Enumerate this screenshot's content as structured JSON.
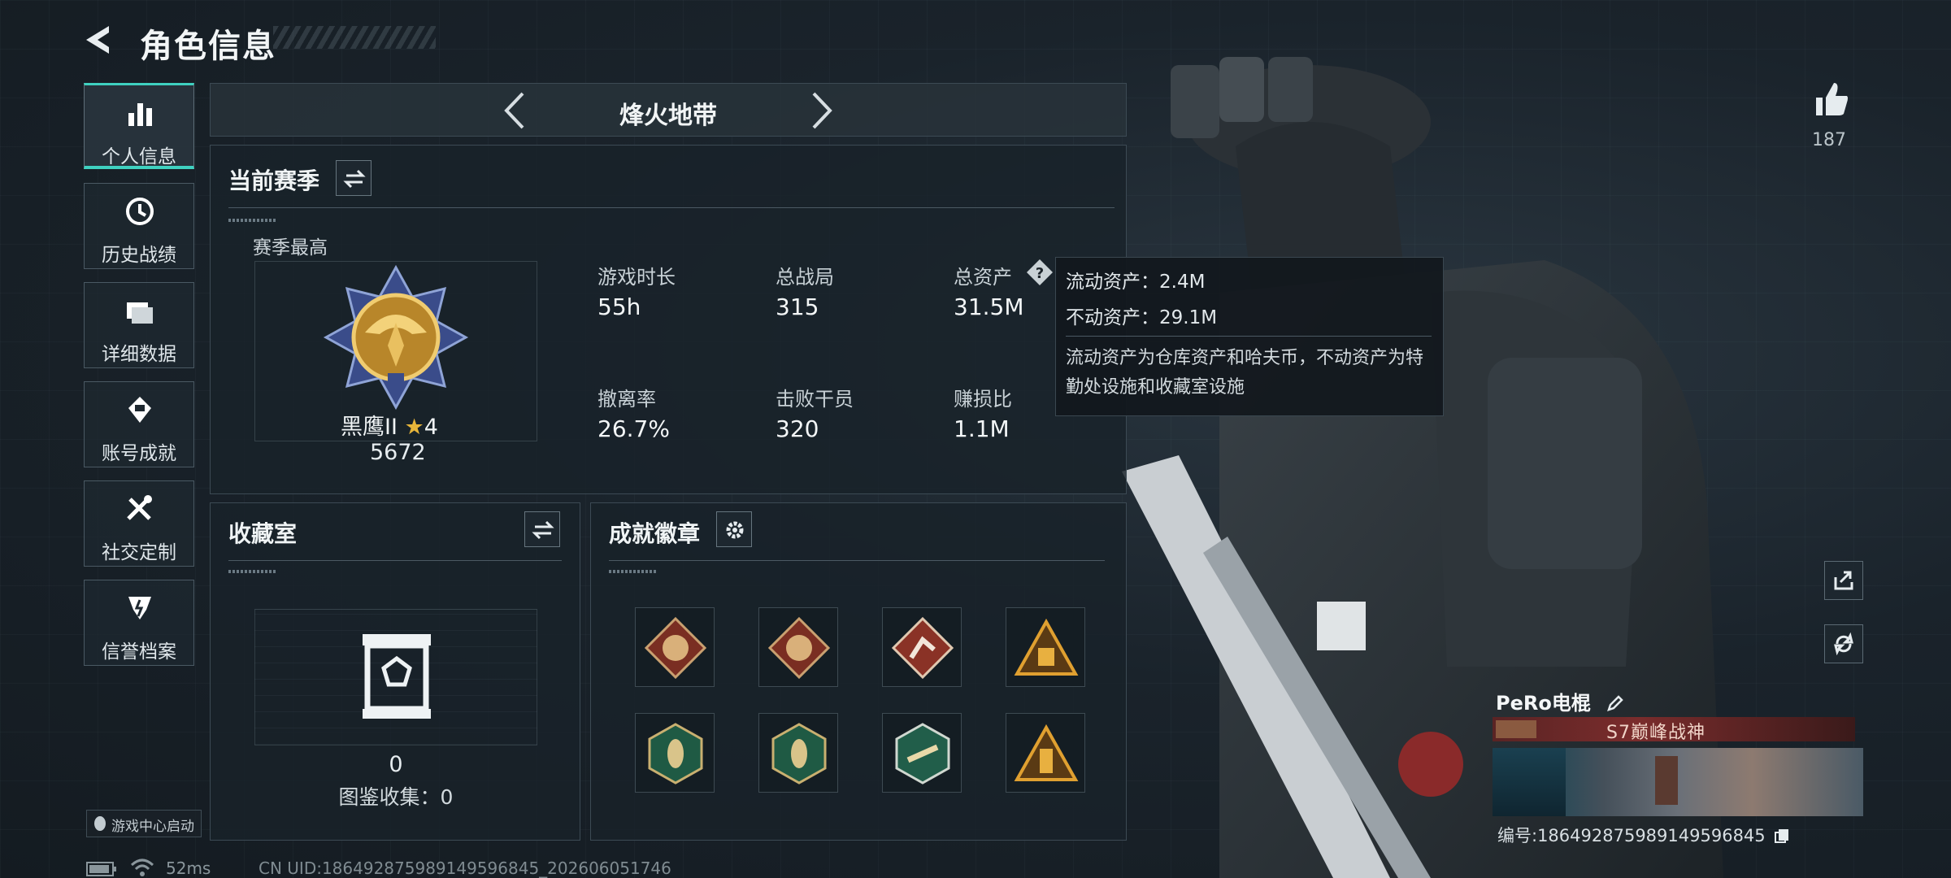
{
  "header": {
    "title": "角色信息"
  },
  "sidebar": {
    "items": [
      {
        "label": "个人信息",
        "icon": "bar-chart-icon",
        "active": true
      },
      {
        "label": "历史战绩",
        "icon": "history-clock-icon",
        "active": false
      },
      {
        "label": "详细数据",
        "icon": "folder-icon",
        "active": false
      },
      {
        "label": "账号成就",
        "icon": "achievement-icon",
        "active": false
      },
      {
        "label": "社交定制",
        "icon": "tools-icon",
        "active": false
      },
      {
        "label": "信誉档案",
        "icon": "shield-emblem-icon",
        "active": false
      }
    ],
    "game_center": "游戏中心启动"
  },
  "mode_switcher": {
    "title": "烽火地带"
  },
  "season": {
    "heading": "当前赛季",
    "best_label": "赛季最高",
    "rank_name": "黑鹰II",
    "rank_stars": "4",
    "rank_score": "5672",
    "stats": [
      {
        "label": "游戏时长",
        "value": "55h"
      },
      {
        "label": "总战局",
        "value": "315"
      },
      {
        "label": "总资产",
        "value": "31.5M"
      },
      {
        "label": "撤离率",
        "value": "26.7%"
      },
      {
        "label": "击败干员",
        "value": "320"
      },
      {
        "label": "赚损比",
        "value": "1.1M"
      }
    ]
  },
  "tooltip": {
    "liquid": "流动资产：2.4M",
    "fixed": "不动资产：29.1M",
    "desc": "流动资产为仓库资产和哈夫币，不动资产为特勤处设施和收藏室设施"
  },
  "collection": {
    "heading": "收藏室",
    "count": "0",
    "catalog": "图鉴收集：0"
  },
  "achievements": {
    "heading": "成就徽章",
    "badges": [
      "dragon-badge-red",
      "dragon-badge-red",
      "runner-badge-red",
      "trophy-badge-gold",
      "wasp-badge-green",
      "wasp-badge-green",
      "gun-badge-green",
      "tower-badge-gold"
    ]
  },
  "right": {
    "like_count": "187",
    "player_name": "PeRo电棍",
    "player_title": "S7巅峰战神",
    "player_id": "编号:18649287598914959684​5"
  },
  "status_bar": {
    "ping": "52ms",
    "uid": "CN UID:18649287598914959684​5_202606051746"
  },
  "colors": {
    "accent": "#3fd1c0",
    "panel_bg": "#19222a",
    "gold": "#d8a840"
  }
}
